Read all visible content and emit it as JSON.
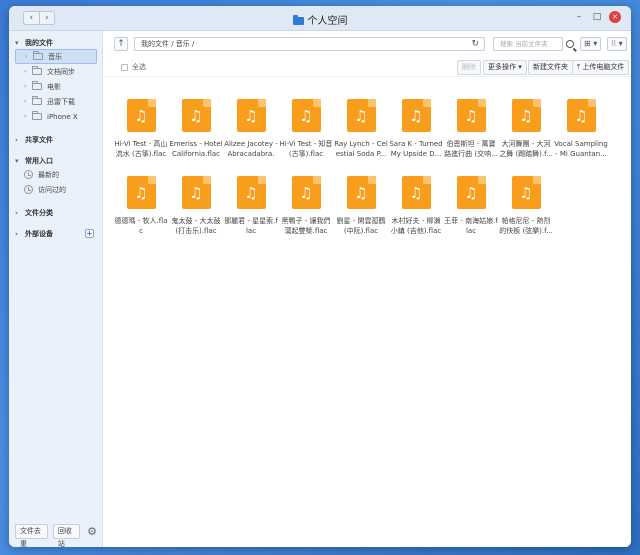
{
  "window": {
    "title": "个人空间",
    "nav_back": "‹",
    "nav_forward": "›"
  },
  "window_controls": {
    "min": "–",
    "max": "□",
    "close": "✕"
  },
  "sidebar": {
    "my_files": "我的文件",
    "items": [
      {
        "label": "音乐",
        "active": true
      },
      {
        "label": "文档同步",
        "active": false
      },
      {
        "label": "电影",
        "active": false
      },
      {
        "label": "迅雷下载",
        "active": false
      },
      {
        "label": "iPhone X",
        "active": false
      }
    ],
    "shared": "共享文件",
    "common": "常用入口",
    "recent": "最新的",
    "visited": "访问过的",
    "categories": "文件分类",
    "external": "外部设备",
    "bottom": {
      "transfers": "文件去重",
      "recycle": "回收站"
    }
  },
  "toolbar": {
    "up": "↑",
    "path": "我的文件 / 音乐 /",
    "refresh": "↻",
    "search_placeholder": "搜索 当前文件夹",
    "view_btn": "⊞ ▾",
    "layout_btn": "⁝⁝ ▾"
  },
  "actions": {
    "select_all": "全选",
    "delete": "删除",
    "more": "更多操作 ▾",
    "new_folder": "新建文件夹",
    "upload": "⤒ 上传电脑文件"
  },
  "files": [
    {
      "name": "Hi-Vi Test - 高山流水 (古箏).flac"
    },
    {
      "name": "Emeriss - Hotel California.flac"
    },
    {
      "name": "Alizee Jacotey - Abracadabra.f..."
    },
    {
      "name": "Hi-Vi Test - 知音 (古箏).flac"
    },
    {
      "name": "Ray Lynch - Celestial Soda P..."
    },
    {
      "name": "Sara K - Turned My Upside D..."
    },
    {
      "name": "伯恩斯坦 - 萬寶路進行曲 (交响..."
    },
    {
      "name": "大河舞團 - 大河之舞 (踢踏舞).f..."
    },
    {
      "name": "Vocal Sampling - Mi Guantan..."
    },
    {
      "name": "德德瑪 - 牧人.flac"
    },
    {
      "name": "鬼太鼓 - 大太鼓 (打击乐).flac"
    },
    {
      "name": "鄧麗君 - 星星索.flac"
    },
    {
      "name": "黑鴨子 - 讓我們蕩起雙槳.flac"
    },
    {
      "name": "劉星 - 閑雲孤鶴 (中阮).flac"
    },
    {
      "name": "木村好夫 - 柳瀨小鎮 (吉他).flac"
    },
    {
      "name": "王菲 - 南海姑娘.flac"
    },
    {
      "name": "帕格尼尼 - 熱烈的快板 (弦樂).f..."
    }
  ],
  "colors": {
    "accent": "#2f7ad8",
    "file_icon": "#f99e1c",
    "close": "#e0413a"
  }
}
